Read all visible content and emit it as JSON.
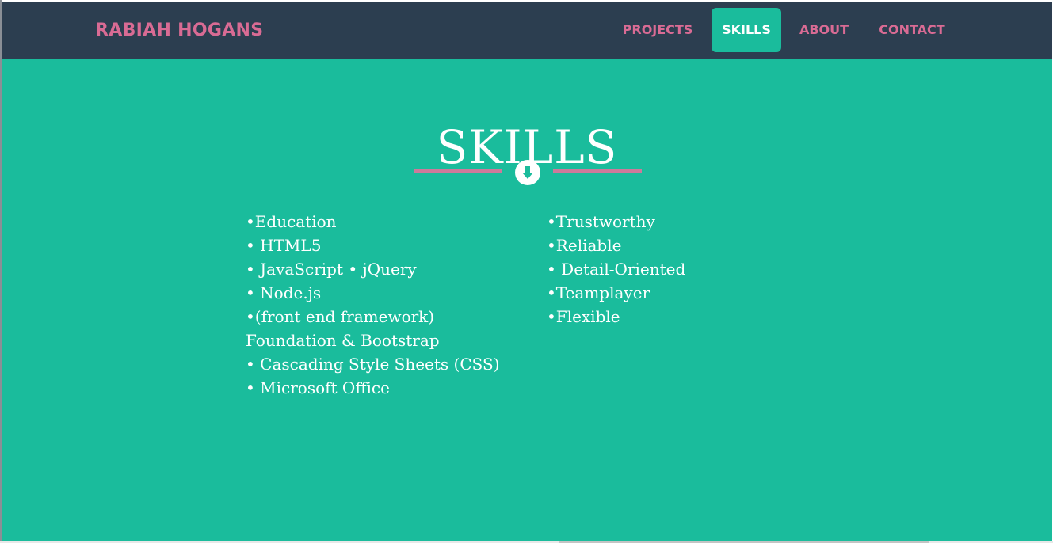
{
  "navbar": {
    "brand": "RABIAH HOGANS",
    "items": [
      {
        "label": "PROJECTS",
        "active": false
      },
      {
        "label": "SKILLS",
        "active": true
      },
      {
        "label": "ABOUT",
        "active": false
      },
      {
        "label": "CONTACT",
        "active": false
      }
    ]
  },
  "section": {
    "title": "SKILLS",
    "divider_icon": "arrow-down-circle-icon",
    "left_skills": [
      "•Education",
      "• HTML5",
      "• JavaScript • jQuery",
      "• Node.js",
      "•(front end framework) Foundation & Bootstrap",
      "• Cascading Style Sheets (CSS)",
      "• Microsoft Office"
    ],
    "right_skills": [
      "•Trustworthy",
      "•Reliable",
      "• Detail-Oriented",
      "•Teamplayer",
      "•Flexible"
    ]
  },
  "colors": {
    "navbar_bg": "#2c3e50",
    "accent_pink": "#d96b94",
    "teal": "#1abc9c",
    "divider_pink": "#cd7a9b"
  }
}
